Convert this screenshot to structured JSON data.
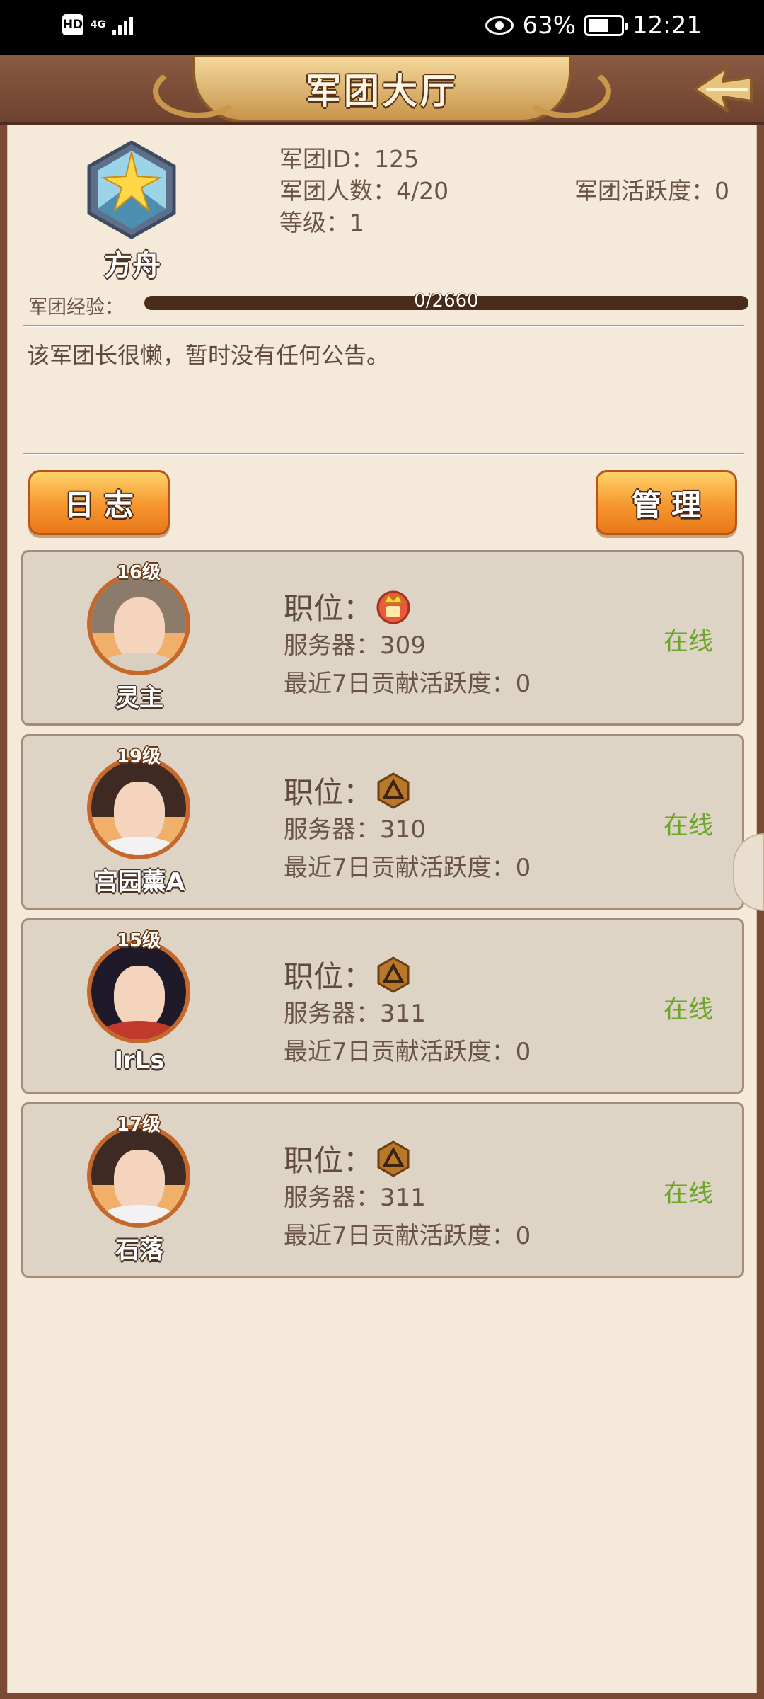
{
  "status_bar": {
    "hd": "HD",
    "network": "4G",
    "battery": "63%",
    "time": "12:21"
  },
  "header": {
    "title": "军团大厅"
  },
  "guild": {
    "name": "方舟",
    "id_text": "军团ID：125",
    "count_text": "军团人数：4/20",
    "level_text": "等级：1",
    "activity_text": "军团活跃度：0",
    "exp_label": "军团经验：",
    "exp_text": "0/2660",
    "exp_current": 0,
    "exp_max": 2660,
    "notice": "该军团长很懒，暂时没有任何公告。"
  },
  "buttons": {
    "log": "日志",
    "manage": "管理"
  },
  "members": [
    {
      "level": "16级",
      "name": "灵主",
      "position_label": "职位：",
      "rank_icon": "leader-badge-icon",
      "server": "服务器：309",
      "contribution": "最近7日贡献活跃度：0",
      "status": "在线"
    },
    {
      "level": "19级",
      "name": "宫园薰A",
      "position_label": "职位：",
      "rank_icon": "member-badge-icon",
      "server": "服务器：310",
      "contribution": "最近7日贡献活跃度：0",
      "status": "在线"
    },
    {
      "level": "15级",
      "name": "IrLs",
      "position_label": "职位：",
      "rank_icon": "member-badge-icon",
      "server": "服务器：311",
      "contribution": "最近7日贡献活跃度：0",
      "status": "在线"
    },
    {
      "level": "17级",
      "name": "石落",
      "position_label": "职位：",
      "rank_icon": "member-badge-icon",
      "server": "服务器：311",
      "contribution": "最近7日贡献活跃度：0",
      "status": "在线"
    }
  ],
  "colors": {
    "panel_bg": "#f5e9da",
    "frame": "#7a4a35",
    "online": "#6ea52b",
    "button": "#f6962e"
  }
}
